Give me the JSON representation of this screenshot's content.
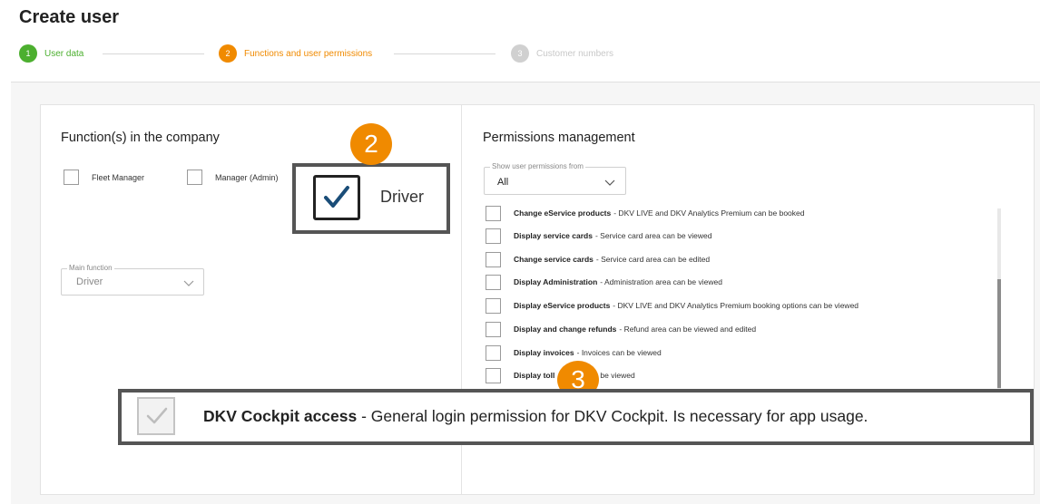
{
  "page": {
    "title": "Create user"
  },
  "stepper": {
    "steps": [
      {
        "num": "1",
        "label": "User data",
        "state": "done"
      },
      {
        "num": "2",
        "label": "Functions and user permissions",
        "state": "active"
      },
      {
        "num": "3",
        "label": "Customer numbers",
        "state": "upcoming"
      }
    ]
  },
  "functions": {
    "title": "Function(s) in the company",
    "options": [
      {
        "label": "Fleet Manager",
        "checked": false
      },
      {
        "label": "Manager (Admin)",
        "checked": false
      },
      {
        "label": "Driver",
        "checked": true
      }
    ],
    "main_function": {
      "legend": "Main function",
      "value": "Driver"
    }
  },
  "permissions": {
    "title": "Permissions management",
    "filter": {
      "legend": "Show user permissions from",
      "value": "All"
    },
    "items": [
      {
        "title": "Change eService products",
        "desc": "- DKV LIVE and DKV Analytics Premium can be booked"
      },
      {
        "title": "Display service cards",
        "desc": "- Service card area can be viewed"
      },
      {
        "title": "Change service cards",
        "desc": "- Service card area can be edited"
      },
      {
        "title": "Display Administration",
        "desc": "- Administration area can be viewed"
      },
      {
        "title": "Display eService products",
        "desc": "- DKV LIVE and DKV Analytics Premium booking options can be viewed"
      },
      {
        "title": "Display and change refunds",
        "desc": "- Refund area can be viewed and edited"
      },
      {
        "title": "Display invoices",
        "desc": "- Invoices can be viewed"
      },
      {
        "title": "Display toll",
        "desc": "can be viewed"
      }
    ],
    "cockpit": {
      "title": "DKV Cockpit access",
      "desc": " - General login permission for DKV Cockpit. Is necessary for app usage.",
      "checked": true
    }
  },
  "callouts": {
    "badge_2": "2",
    "badge_3": "3"
  },
  "colors": {
    "accent": "#f08a00",
    "done": "#4caf2f",
    "inactive": "#d0d0d0"
  },
  "icons": [
    "checkmark-icon",
    "chevron-down-icon"
  ]
}
